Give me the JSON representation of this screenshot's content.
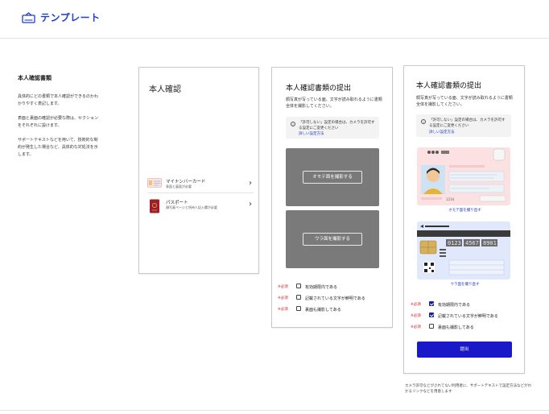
{
  "header": {
    "title": "テンプレート",
    "icon": "id-card-icon",
    "accent": "#1f3fc4"
  },
  "intro": {
    "heading": "本人確認書類",
    "paragraphs": [
      "具体的にどの書類で本人確認ができるのかわかりやすく表記します。",
      "表面と裏面の確認が必要な際は、セクションをそれぞれに設けます。",
      "サポートテキストなどを用いて、技術的な制約が発生した場合など、具体的な対処法を示します。"
    ]
  },
  "card1": {
    "title": "本人確認",
    "items": [
      {
        "label": "マイナンバーカード",
        "sub": "表面と裏面が必要",
        "icon": "my-number-card-icon"
      },
      {
        "label": "パスポート",
        "sub": "顔写真ページと所持人記入欄が必要",
        "icon": "passport-icon"
      }
    ]
  },
  "card2": {
    "title": "本人確認書類の提出",
    "description": "顔写真が写っている面、文字が読み取れるように書類全体を撮影してください。",
    "notice": "「許可しない」設定の場合は、カメラを許可する設定にご変更ください",
    "notice_link": "詳しい設定方法",
    "front_button": "オモテ面を撮影する",
    "back_button": "ウラ面を撮影する",
    "checks": [
      {
        "required": "※必須",
        "label": "有効期限内である",
        "checked": false
      },
      {
        "required": "※必須",
        "label": "記載されている文字が鮮明である",
        "checked": false
      },
      {
        "required": "※必須",
        "label": "裏面も撮影してある",
        "checked": false
      }
    ]
  },
  "card3": {
    "title": "本人確認書類の提出",
    "description": "顔写真が写っている面、文字が読み取れるように書類全体を撮影してください。",
    "notice": "「許可しない」設定の場合は、カメラを許可する設定にご変更ください",
    "notice_link": "詳しい設定方法",
    "front_card": {
      "number_fragment": "1234"
    },
    "front_link": "オモテ面を撮り直す",
    "back_card": {
      "numbers": [
        "0123",
        "4567",
        "8901"
      ]
    },
    "back_link": "ウラ面を撮り直す",
    "checks": [
      {
        "required": "※必須",
        "label": "有効期限内である",
        "checked": true
      },
      {
        "required": "※必須",
        "label": "記載されている文字が鮮明である",
        "checked": true
      },
      {
        "required": "※必須",
        "label": "裏面も撮影してある",
        "checked": false
      }
    ],
    "submit": "提出",
    "submit_color": "#1919c8"
  },
  "footnote": "カメラ許可などがされてない利用者に、サポートテキストで設定方法などがわかるリンクなどを用意します"
}
